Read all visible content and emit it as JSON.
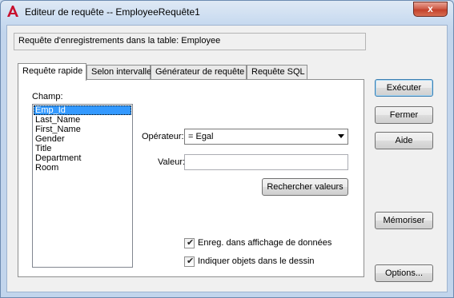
{
  "window": {
    "title": "Editeur de requête -- EmployeeRequête1",
    "close_label": "x"
  },
  "info": {
    "text": "Requête d'enregistrements dans la table:  Employee"
  },
  "tabs": [
    {
      "label": "Requête rapide"
    },
    {
      "label": "Selon intervalle"
    },
    {
      "label": "Générateur de requête"
    },
    {
      "label": "Requête SQL"
    }
  ],
  "panel": {
    "field_label": "Champ:",
    "fields": [
      "Emp_Id",
      "Last_Name",
      "First_Name",
      "Gender",
      "Title",
      "Department",
      "Room"
    ],
    "operator_label": "Opérateur:",
    "operator_value": "=   Egal",
    "value_label": "Valeur:",
    "value_text": "",
    "search_values_label": "Rechercher valeurs",
    "check_store_label": "Enreg. dans affichage de données",
    "check_indicate_label": "Indiquer objets dans le dessin"
  },
  "buttons": {
    "execute": "Exécuter",
    "close": "Fermer",
    "help": "Aide",
    "memorize": "Mémoriser",
    "options": "Options..."
  },
  "colors": {
    "accent_red": "#c8102e",
    "selection": "#3399ff"
  }
}
